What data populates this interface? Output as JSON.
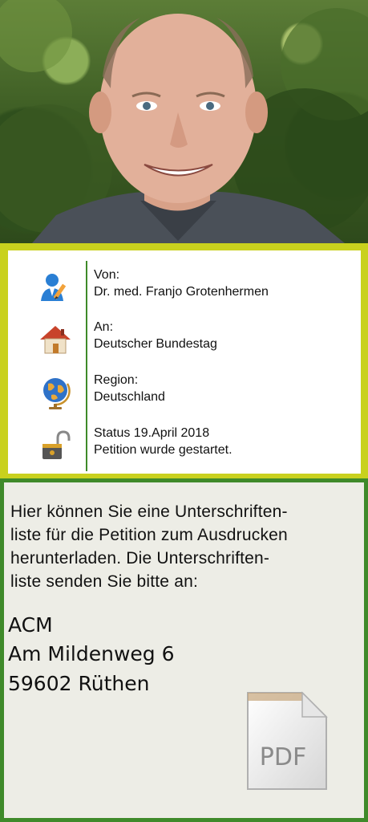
{
  "info": {
    "from_label": "Von:",
    "from_value": "Dr. med. Franjo Grotenhermen",
    "to_label": "An:",
    "to_value": "Deutscher Bundestag",
    "region_label": "Region:",
    "region_value": "Deutschland",
    "status_label": "Status 19.April 2018",
    "status_value": "Petition wurde gestartet."
  },
  "download": {
    "text_lines": [
      "Hier können Sie eine Unterschriften-",
      "liste für die Petition zum Ausdrucken",
      "herunterladen. Die Unterschriften-",
      "liste senden Sie bitte an:"
    ],
    "address": [
      "ACM",
      "Am Mildenweg 6",
      "59602 Rüthen"
    ],
    "pdf_label": "PDF"
  },
  "colors": {
    "frame_top": "#c9d11e",
    "frame_bottom": "#3f8a2a",
    "divider": "#3f8a2a"
  }
}
